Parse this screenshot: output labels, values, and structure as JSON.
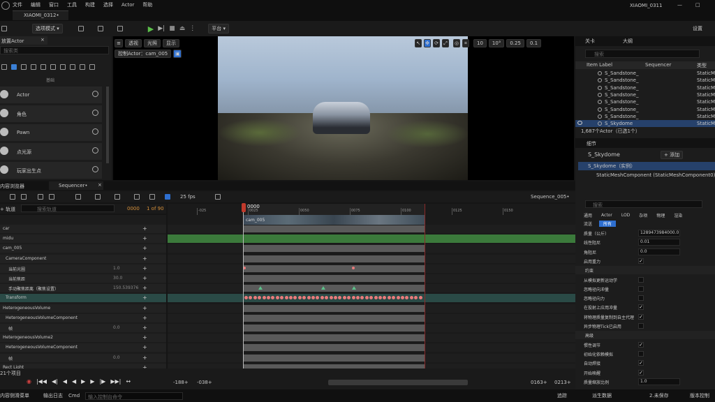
{
  "titlebar": {
    "menus": [
      "文件",
      "编辑",
      "窗口",
      "工具",
      "构建",
      "选择",
      "Actor",
      "帮助"
    ],
    "project_tab": "XIAOMI_0312•",
    "project_name": "XIAOMI_0311"
  },
  "toolbar": {
    "mode": "选项模式",
    "platform": "平台",
    "settings": "设置"
  },
  "place_actors": {
    "title": "放置Actor",
    "search_placeholder": "搜索类",
    "category": "基础",
    "items": [
      "Actor",
      "角色",
      "Pawn",
      "点光源",
      "玩家出生点"
    ]
  },
  "viewport": {
    "perspective": "透视",
    "lit": "光照",
    "show": "显示",
    "pilot": "控制Actor：cam_005",
    "grid_size": "10",
    "rot_size": "10°",
    "scale_size": "0.25",
    "cam_speed": "0.1"
  },
  "outliner": {
    "tab1": "关卡",
    "tab2": "大纲",
    "search_placeholder": "搜索",
    "col_label": "Item Label",
    "col_seq": "Sequencer",
    "col_type": "类型",
    "rows": [
      {
        "label": "S_Sandstone_",
        "type": "StaticM"
      },
      {
        "label": "S_Sandstone_",
        "type": "StaticM"
      },
      {
        "label": "S_Sandstone_",
        "type": "StaticM"
      },
      {
        "label": "S_Sandstone_",
        "type": "StaticM"
      },
      {
        "label": "S_Sandstone_",
        "type": "StaticM"
      },
      {
        "label": "S_Sandstone_",
        "type": "StaticM"
      },
      {
        "label": "S_Sandstone_",
        "type": "StaticM"
      },
      {
        "label": "S_Skydome",
        "type": "StaticM"
      }
    ],
    "status": "1,687个Actor（已选1个）"
  },
  "details": {
    "tab": "细节",
    "actor": "S_Skydome",
    "add": "+ 添加",
    "instance": "S_Skydome（实例）",
    "component": "StaticMeshComponent (StaticMeshComponent0)",
    "search_placeholder": "搜索",
    "filter_tabs": [
      "通用",
      "Actor",
      "LOD",
      "杂项",
      "物理",
      "渲染"
    ],
    "filter_tabs2": [
      "流送",
      "所有"
    ],
    "rows": [
      {
        "label": "质量（公斤）",
        "value": "1289473984000.0"
      },
      {
        "label": "线性阻尼",
        "value": "0.01"
      },
      {
        "label": "角阻尼",
        "value": "0.0"
      },
      {
        "label": "启用重力",
        "value": "check"
      },
      {
        "label": "约束",
        "value": "section"
      },
      {
        "label": "从模拟更新运动学",
        "value": "box"
      },
      {
        "label": "忽略径向冲量",
        "value": "box"
      },
      {
        "label": "忽略径向力",
        "value": "box"
      },
      {
        "label": "在投射上应用冲量",
        "value": "check"
      },
      {
        "label": "将物理质量复制到自主代理",
        "value": "check"
      },
      {
        "label": "异步物理Tick已启用",
        "value": "box"
      },
      {
        "label": "高级",
        "value": "section"
      },
      {
        "label": "惯性调节",
        "value": "check"
      },
      {
        "label": "初始化依赖模拟",
        "value": "box"
      },
      {
        "label": "自动焊接",
        "value": "check"
      },
      {
        "label": "开始唤醒",
        "value": "check"
      },
      {
        "label": "质量缩放比例",
        "value": "1.0"
      }
    ]
  },
  "tabs_bottom": {
    "content": "内容浏览器",
    "sequencer": "Sequencer•"
  },
  "sequencer": {
    "fps": "25 fps",
    "name": "Sequence_005•",
    "track_btn": "+ 轨道",
    "search_placeholder": "搜索轨道",
    "frame": "0000",
    "of": "1 of 90",
    "playhead": "0000",
    "ruler": [
      "-025",
      "0025",
      "0050",
      "0075",
      "0100",
      "0125",
      "0150"
    ],
    "shot_label": "cam_005",
    "footer_left": [
      "-188+",
      "-038+"
    ],
    "footer_right": [
      "0163+",
      "0213+"
    ],
    "items_count": "21个项目",
    "tracks": [
      {
        "name": "car",
        "val": "",
        "indent": 0
      },
      {
        "name": "midu",
        "val": "",
        "indent": 0
      },
      {
        "name": "cam_005",
        "val": "",
        "indent": 0
      },
      {
        "name": "CameraComponent",
        "val": "",
        "indent": 1
      },
      {
        "name": "当前光圈",
        "val": "1.0",
        "indent": 2
      },
      {
        "name": "当前焦距",
        "val": "30.0",
        "indent": 2
      },
      {
        "name": "手动聚焦距离（聚焦设置）",
        "val": "150.539376",
        "indent": 2
      },
      {
        "name": "Transform",
        "val": "",
        "indent": 1
      },
      {
        "name": "HeterogeneousVolume",
        "val": "",
        "indent": 0
      },
      {
        "name": "HeterogeneousVolumeComponent",
        "val": "",
        "indent": 1
      },
      {
        "name": "帧",
        "val": "0.0",
        "indent": 2
      },
      {
        "name": "HeterogeneousVolume2",
        "val": "",
        "indent": 0
      },
      {
        "name": "HeterogeneousVolumeComponent",
        "val": "",
        "indent": 1
      },
      {
        "name": "帧",
        "val": "0.0",
        "indent": 2
      },
      {
        "name": "Rect Light",
        "val": "",
        "indent": 0
      }
    ]
  },
  "statusbar": {
    "drawer": "内容侧滑菜单",
    "log": "输出日志",
    "cmd": "Cmd",
    "cmd_placeholder": "输入控制台命令",
    "trace": "追踪",
    "derived": "派生数据",
    "save": "2.未保存",
    "source": "版本控制"
  }
}
